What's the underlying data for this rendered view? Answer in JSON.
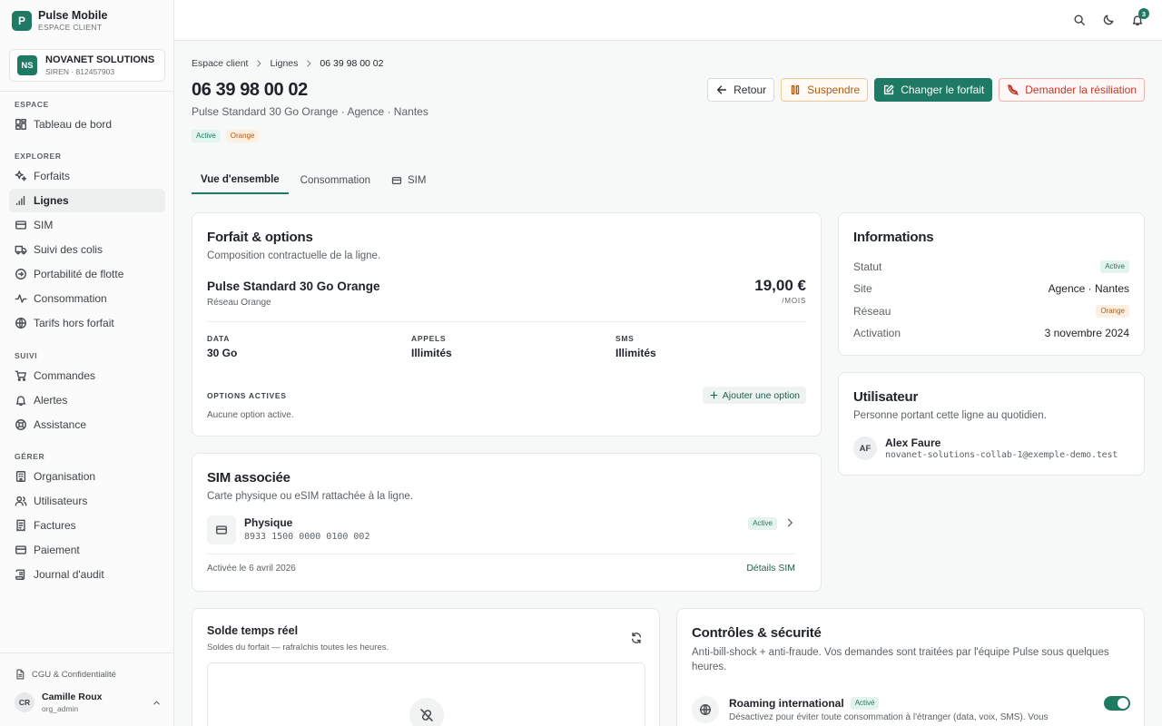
{
  "brand": {
    "logo": "P",
    "name": "Pulse Mobile",
    "subtitle": "ESPACE CLIENT"
  },
  "org": {
    "initials": "NS",
    "name": "NOVANET SOLUTIONS",
    "siren": "SIREN · 812457903"
  },
  "nav": {
    "sections": {
      "espace": "ESPACE",
      "explorer": "EXPLORER",
      "suivi": "SUIVI",
      "gerer": "GÉRER"
    },
    "items": {
      "tableau": "Tableau de bord",
      "forfaits": "Forfaits",
      "lignes": "Lignes",
      "sim": "SIM",
      "colis": "Suivi des colis",
      "portabilite": "Portabilité de flotte",
      "consommation": "Consommation",
      "tarifs": "Tarifs hors forfait",
      "commandes": "Commandes",
      "alertes": "Alertes",
      "assistance": "Assistance",
      "organisation": "Organisation",
      "utilisateurs": "Utilisateurs",
      "factures": "Factures",
      "paiement": "Paiement",
      "audit": "Journal d'audit"
    },
    "active": "lignes"
  },
  "footer": {
    "cgu": "CGU & Confidentialité"
  },
  "user": {
    "initials": "CR",
    "name": "Camille Roux",
    "role": "org_admin"
  },
  "topbar": {
    "notifications": "3"
  },
  "breadcrumb": {
    "home": "Espace client",
    "section": "Lignes",
    "current": "06 39 98 00 02"
  },
  "header": {
    "title": "06 39 98 00 02",
    "subtitle": "Pulse Standard 30 Go Orange · Agence · Nantes",
    "status_badge": "Active",
    "network_badge": "Orange"
  },
  "actions": {
    "back": "Retour",
    "suspend": "Suspendre",
    "change_plan": "Changer le forfait",
    "terminate": "Demander la résiliation"
  },
  "tabs": {
    "overview": "Vue d'ensemble",
    "consumption": "Consommation",
    "sim": "SIM"
  },
  "plan_card": {
    "title": "Forfait & options",
    "subtitle": "Composition contractuelle de la ligne.",
    "plan_name": "Pulse Standard 30 Go Orange",
    "network": "Réseau Orange",
    "price": "19,00 €",
    "price_unit": "/MOIS",
    "data_label": "DATA",
    "data_value": "30 Go",
    "calls_label": "APPELS",
    "calls_value": "Illimités",
    "sms_label": "SMS",
    "sms_value": "Illimités",
    "options_label": "OPTIONS ACTIVES",
    "add_option": "Ajouter une option",
    "no_options": "Aucune option active."
  },
  "info_card": {
    "title": "Informations",
    "status_label": "Statut",
    "status_value": "Active",
    "site_label": "Site",
    "site_value": "Agence · Nantes",
    "network_label": "Réseau",
    "network_value": "Orange",
    "activation_label": "Activation",
    "activation_value": "3 novembre 2024"
  },
  "user_card": {
    "title": "Utilisateur",
    "subtitle": "Personne portant cette ligne au quotidien.",
    "initials": "AF",
    "name": "Alex Faure",
    "email": "novanet-solutions-collab-1@exemple-demo.test"
  },
  "sim_card": {
    "title": "SIM associée",
    "subtitle": "Carte physique ou eSIM rattachée à la ligne.",
    "type": "Physique",
    "iccid": "8933 1500 0000 0100 002",
    "status": "Active",
    "activated": "Activée le 6 avril 2026",
    "details_link": "Détails SIM"
  },
  "balance_card": {
    "title": "Solde temps réel",
    "subtitle": "Soldes du forfait — rafraîchis toutes les heures."
  },
  "controls_card": {
    "title": "Contrôles & sécurité",
    "subtitle": "Anti-bill-shock + anti-fraude. Vos demandes sont traitées par l'équipe Pulse sous quelques heures.",
    "roaming_title": "Roaming international",
    "roaming_badge": "Activé",
    "roaming_desc": "Désactivez pour éviter toute consommation à l'étranger (data, voix, SMS). Vous",
    "roaming_enabled": true
  },
  "colors": {
    "accent": "#1f7a63",
    "warn": "#b25b12",
    "danger": "#c0392b"
  }
}
